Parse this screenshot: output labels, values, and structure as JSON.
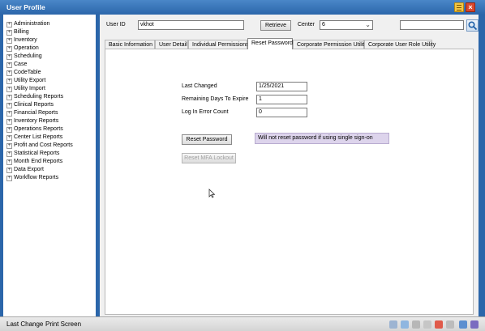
{
  "window": {
    "title": "User Profile"
  },
  "tree": [
    "Administration",
    "Billing",
    "Inventory",
    "Operation",
    "Scheduling",
    "Case",
    "CodeTable",
    "Utility Export",
    "Utility Import",
    "Scheduling Reports",
    "Clinical Reports",
    "Financial Reports",
    "Inventory Reports",
    "Operations Reports",
    "Center List Reports",
    "Profit and Cost Reports",
    "Statistical Reports",
    "Month End Reports",
    "Data Export",
    "Workflow Reports"
  ],
  "header": {
    "user_id_label": "User ID",
    "user_id_value": "vkhot",
    "retrieve_label": "Retrieve",
    "center_label": "Center",
    "center_value": "6",
    "search_value": ""
  },
  "tabs": [
    "Basic Information",
    "User Detail",
    "Individual Permissions",
    "Reset Password",
    "Corporate Permission Utility",
    "Corporate User Role Utility"
  ],
  "active_tab": "Reset Password",
  "reset_password": {
    "last_changed_label": "Last Changed",
    "last_changed_value": "1/25/2021",
    "remaining_days_label": "Remaining Days To Expire",
    "remaining_days_value": "1",
    "login_error_label": "Log In Error Count",
    "login_error_value": "0",
    "reset_button": "Reset Password",
    "sso_note": "Will not reset password if using single sign-on",
    "reset_mfa_button": "Reset MFA Lockout"
  },
  "statusbar": {
    "last_change": "Last Change",
    "print_screen": "Print Screen"
  },
  "colors": {
    "titlebar": "#2b66aa",
    "note_bg": "#ddd4ec",
    "frame": "#2b66aa"
  }
}
